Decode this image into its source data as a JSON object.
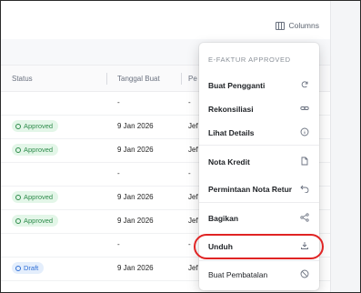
{
  "toolbar": {
    "columns_label": "Columns"
  },
  "table": {
    "headers": {
      "status": "Status",
      "tanggal_buat": "Tanggal Buat",
      "third": "Pe"
    },
    "rows": [
      {
        "status": "",
        "tanggal": "-",
        "author": "-"
      },
      {
        "status": "Approved",
        "status_type": "approved",
        "tanggal": "9 Jan 2026",
        "author": "Jef"
      },
      {
        "status": "Approved",
        "status_type": "approved",
        "tanggal": "9 Jan 2026",
        "author": "Jef"
      },
      {
        "status": "",
        "tanggal": "-",
        "author": "-"
      },
      {
        "status": "Approved",
        "status_type": "approved",
        "tanggal": "9 Jan 2026",
        "author": "Jef"
      },
      {
        "status": "Approved",
        "status_type": "approved",
        "tanggal": "9 Jan 2026",
        "author": "Jef"
      },
      {
        "status": "",
        "tanggal": "-",
        "author": "-"
      },
      {
        "status": "Draft",
        "status_type": "draft",
        "tanggal": "9 Jan 2026",
        "author": "Jef"
      }
    ]
  },
  "menu": {
    "header": "E-FAKTUR APPROVED",
    "items": [
      {
        "label": "Buat Pengganti",
        "icon": "refresh-icon"
      },
      {
        "label": "Rekonsiliasi",
        "icon": "link-icon"
      },
      {
        "label": "Lihat Details",
        "icon": "info-icon"
      },
      {
        "label": "Nota Kredit",
        "icon": "document-icon"
      },
      {
        "label": "Permintaan Nota Retur",
        "icon": "return-icon"
      },
      {
        "label": "Bagikan",
        "icon": "share-icon"
      },
      {
        "label": "Unduh",
        "icon": "download-icon"
      },
      {
        "label": "Buat Pembatalan",
        "icon": "cancel-icon"
      }
    ]
  },
  "colors": {
    "highlight": "#e02424",
    "approved": "#2e8b4b",
    "draft": "#2f6fd6"
  }
}
